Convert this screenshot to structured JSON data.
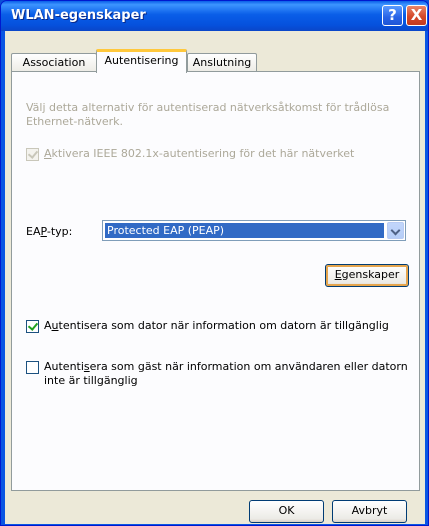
{
  "window": {
    "title": "WLAN-egenskaper",
    "help_icon": "?",
    "close_icon": "X"
  },
  "tabs": [
    {
      "label": "Association"
    },
    {
      "label": "Autentisering"
    },
    {
      "label": "Anslutning"
    }
  ],
  "auth": {
    "description": "Välj detta alternativ för autentiserad nätverksåtkomst för trådlösa Ethernet-nätverk.",
    "enable_8021x": {
      "label_accel": "A",
      "label_rest": "ktivera IEEE 802.1x-autentisering för det här nätverket",
      "checked": true,
      "disabled": true
    },
    "eap_label_pre": "EA",
    "eap_label_accel": "P",
    "eap_label_post": "-typ:",
    "eap_value": "Protected EAP (PEAP)",
    "properties_accel": "E",
    "properties_rest": "genskaper",
    "computer_auth": {
      "label_pre": "A",
      "label_accel": "u",
      "label_rest": "tentisera som dator när information om datorn är tillgänglig",
      "checked": true
    },
    "guest_auth": {
      "label_pre": "Autenti",
      "label_accel": "s",
      "label_rest": "era som gäst när information om användaren eller datorn inte är tillgänglig",
      "checked": false
    }
  },
  "footer": {
    "ok_label": "OK",
    "cancel_label": "Avbryt"
  }
}
